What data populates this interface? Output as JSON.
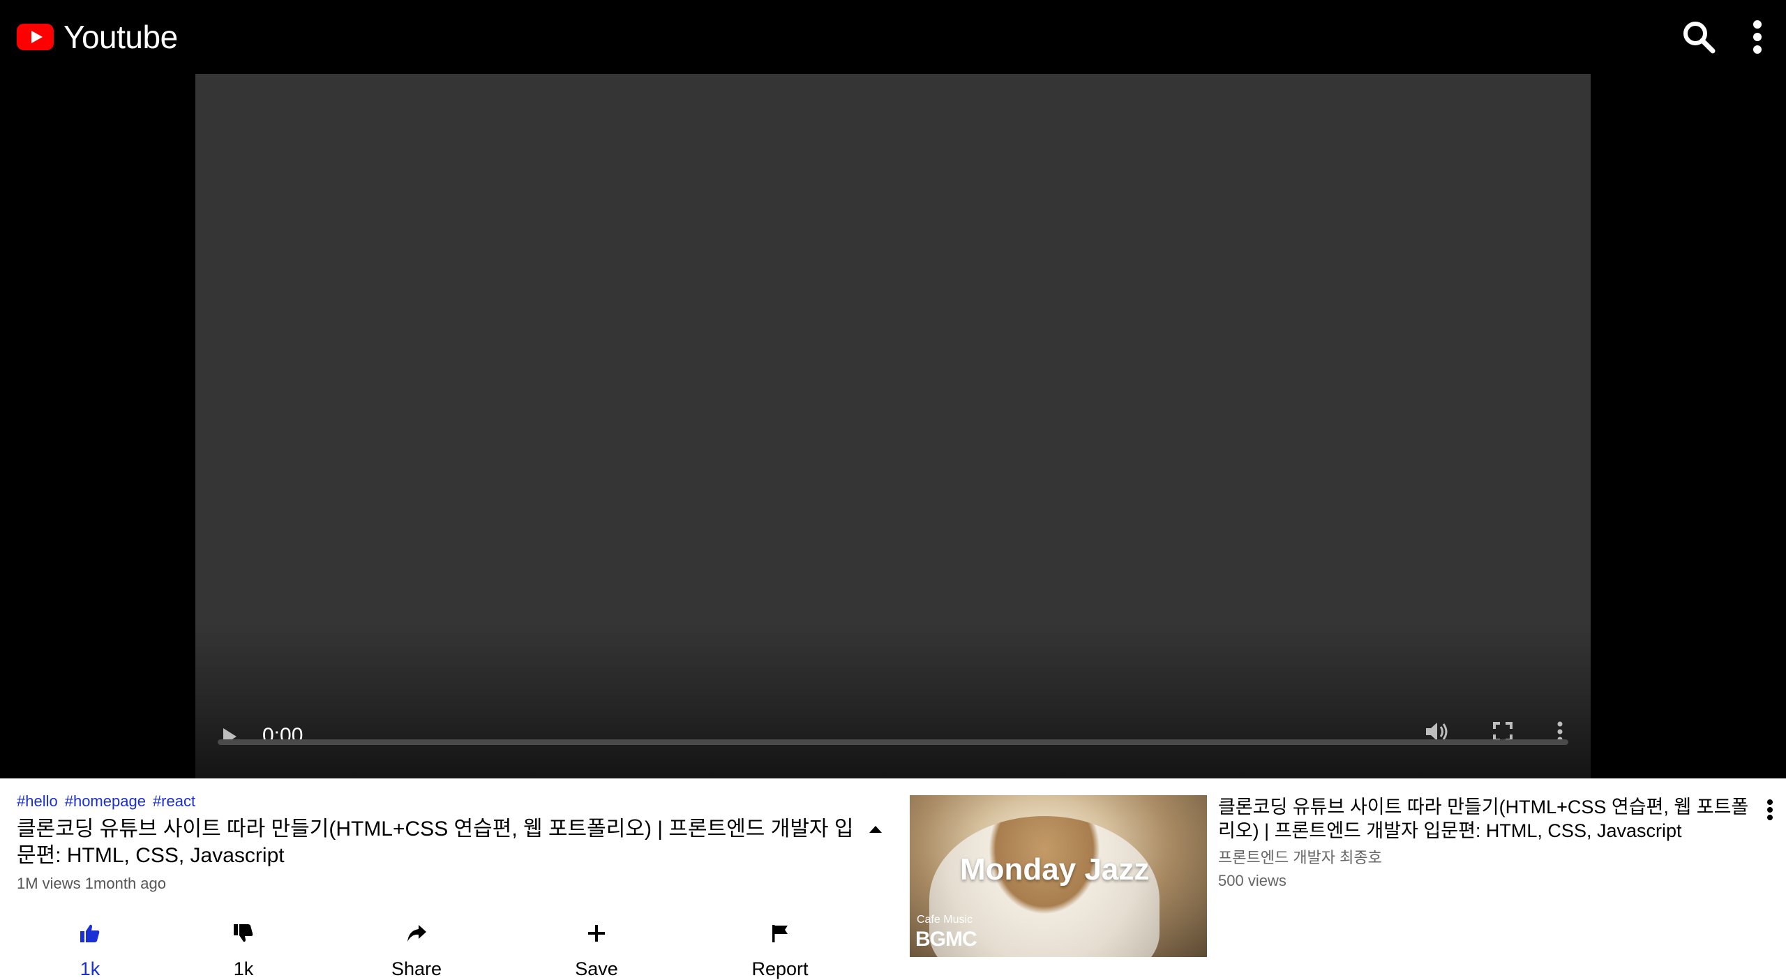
{
  "header": {
    "brand": "Youtube",
    "search_icon": "search-icon",
    "more_icon": "more-vertical-icon"
  },
  "player": {
    "time": "0:00",
    "progress": 0,
    "icons": [
      "play-icon",
      "volume-icon",
      "fullscreen-icon",
      "more-vertical-icon"
    ]
  },
  "video": {
    "tags": [
      "#hello",
      "#homepage",
      "#react"
    ],
    "title": "클론코딩 유튜브 사이트 따라 만들기(HTML+CSS 연습편, 웹 포트폴리오) | 프론트엔드 개발자 입문편: HTML, CSS, Javascript",
    "meta": "1M views 1month ago",
    "actions": [
      {
        "label": "1k",
        "icon": "thumbs-up-icon"
      },
      {
        "label": "1k",
        "icon": "thumbs-down-icon"
      },
      {
        "label": "Share",
        "icon": "share-icon"
      },
      {
        "label": "Save",
        "icon": "plus-icon"
      },
      {
        "label": "Report",
        "icon": "flag-icon"
      }
    ]
  },
  "up_next": {
    "thumbnail_title": "Monday Jazz",
    "thumbnail_subtitle": "Cafe Music",
    "thumbnail_brand": "BGMC",
    "title": "클론코딩 유튜브 사이트 따라 만들기(HTML+CSS 연습편, 웹 포트폴리오) | 프론트엔드 개발자 입문편: HTML, CSS, Javascript",
    "channel": "프론트엔드 개발자 최종호",
    "views": "500 views"
  },
  "colors": {
    "accent": "#1a2fd6",
    "brand_red": "#ff0000"
  }
}
